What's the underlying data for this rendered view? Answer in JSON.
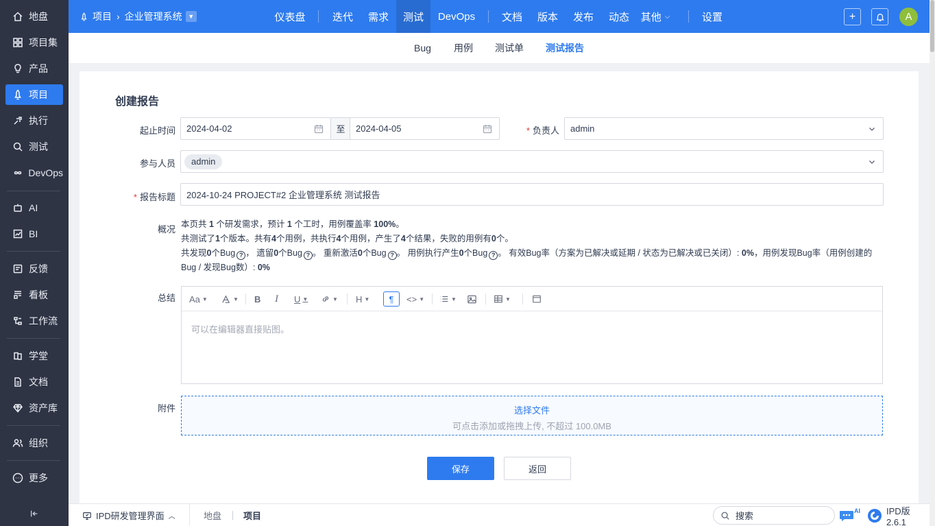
{
  "sidebar": {
    "items": [
      {
        "label": "地盘",
        "icon": "home-icon"
      },
      {
        "label": "项目集",
        "icon": "grid-icon"
      },
      {
        "label": "产品",
        "icon": "bulb-icon"
      },
      {
        "label": "项目",
        "icon": "rocket-icon"
      },
      {
        "label": "执行",
        "icon": "run-icon"
      },
      {
        "label": "测试",
        "icon": "magnifier-icon"
      },
      {
        "label": "DevOps",
        "icon": "infinity-icon"
      },
      {
        "label": "AI",
        "icon": "robot-icon"
      },
      {
        "label": "BI",
        "icon": "chart-icon"
      },
      {
        "label": "反馈",
        "icon": "feedback-icon"
      },
      {
        "label": "看板",
        "icon": "kanban-icon"
      },
      {
        "label": "工作流",
        "icon": "workflow-icon"
      },
      {
        "label": "学堂",
        "icon": "school-icon"
      },
      {
        "label": "文档",
        "icon": "doc-icon"
      },
      {
        "label": "资产库",
        "icon": "diamond-icon"
      },
      {
        "label": "组织",
        "icon": "people-icon"
      },
      {
        "label": "更多",
        "icon": "more-icon"
      }
    ]
  },
  "topbar": {
    "breadcrumb_root": "项目",
    "breadcrumb_project": "企业管理系统",
    "nav": [
      "仪表盘",
      "迭代",
      "需求",
      "测试",
      "DevOps",
      "文档",
      "版本",
      "发布",
      "动态",
      "其他",
      "设置"
    ],
    "avatar_letter": "A",
    "accent_color": "#2e7bef"
  },
  "subnav": {
    "tabs": [
      "Bug",
      "用例",
      "测试单",
      "测试报告"
    ],
    "active": "测试报告"
  },
  "form": {
    "title": "创建报告",
    "date_label": "起止时间",
    "date_start": "2024-04-02",
    "date_to": "至",
    "date_end": "2024-04-05",
    "owner_label": "负责人",
    "owner_value": "admin",
    "members_label": "参与人员",
    "members_tag": "admin",
    "report_title_label": "报告标题",
    "report_title_value": "2024-10-24 PROJECT#2 企业管理系统 测试报告",
    "overview_label": "概况",
    "summary_label": "总结",
    "editor_placeholder": "可以在编辑器直接贴图。",
    "attachment_label": "附件",
    "upload_title": "选择文件",
    "upload_hint": "可点击添加或拖拽上传, 不超过 100.0MB",
    "save_label": "保存",
    "back_label": "返回"
  },
  "overview": {
    "l1_a": "本页共 ",
    "l1_n1": "1",
    "l1_b": " 个研发需求，预计 ",
    "l1_n2": "1",
    "l1_c": " 个工时，用例覆盖率 ",
    "l1_n3": "100%",
    "l1_d": "。",
    "l2_a": "共测试了",
    "l2_n1": "1",
    "l2_b": "个版本。共有",
    "l2_n2": "4",
    "l2_c": "个用例，共执行",
    "l2_n3": "4",
    "l2_d": "个用例，产生了",
    "l2_n4": "4",
    "l2_e": "个结果，失败的用例有",
    "l2_n5": "0",
    "l2_f": "个。",
    "l3_a": "共发现",
    "l3_n1": "0",
    "l3_b": "个Bug",
    "l3_c": "， 遗留",
    "l3_n2": "0",
    "l3_d": "个Bug",
    "l3_e": "。 重新激活",
    "l3_n3": "0",
    "l3_f": "个Bug",
    "l3_g": "。 用例执行产生",
    "l3_n4": "0",
    "l3_h": "个Bug",
    "l3_i": "。 有效Bug率（方案为已解决或延期 / 状态为已解决或已关闭）: ",
    "l3_n5": "0%",
    "l3_j": "，用例发现Bug率（用例创建的Bug / 发现Bug数）: ",
    "l3_n6": "0%"
  },
  "footer": {
    "view_label": "IPD研发管理界面",
    "crumb_1": "地盘",
    "crumb_2": "项目",
    "search_placeholder": "搜索",
    "ai_badge": "AI",
    "version": "IPD版2.6.1"
  }
}
